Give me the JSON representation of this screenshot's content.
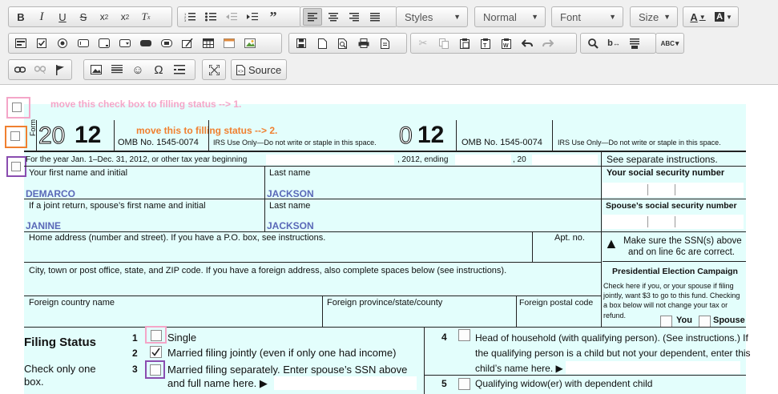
{
  "toolbar": {
    "styles_label": "Styles",
    "format_label": "Normal",
    "font_label": "Font",
    "size_label": "Size",
    "source_label": "Source"
  },
  "notes": {
    "note1": "move this check box to filling status --> 1.",
    "note2": "move this to filling status --> 2."
  },
  "form_header": {
    "form_word": "Form",
    "year_1": "20",
    "year_2": "12",
    "omb_1": "OMB No. 1545-0074",
    "irs_1": "IRS Use Only—Do not write or staple in this space.",
    "year_3": "0",
    "year_4": "12",
    "omb_2": "OMB No. 1545-0074",
    "irs_2": "IRS Use Only—Do not write or staple in this space."
  },
  "form": {
    "year_line": "For the year Jan. 1–Dec. 31, 2012, or other tax year beginning",
    "ending": ", 2012, ending",
    "comma20": ", 20",
    "see_instructions": "See separate instructions.",
    "first_name_label": "Your first name and initial",
    "last_name_label": "Last name",
    "ssn_label": "Your social security number",
    "first_name": "DEMARCO",
    "last_name": "JACKSON",
    "spouse_label": "If a joint return, spouse’s first name and initial",
    "spouse_last_label": "Last name",
    "spouse_ssn_label": "Spouse’s social security number",
    "spouse_first": "JANINE",
    "spouse_last": "JACKSON",
    "address_label": "Home address (number and street). If you have a P.O. box, see instructions.",
    "apt_label": "Apt. no.",
    "ssn_warning_1": "Make sure the SSN(s) above",
    "ssn_warning_2": "and on line 6c are correct.",
    "city_label": "City, town or post office, state, and ZIP code. If you have a foreign address, also complete spaces below (see instructions).",
    "pec_title": "Presidential Election Campaign",
    "pec_text_1": "Check here if you, or your spouse if filing",
    "pec_text_2": "jointly, want $3 to go to this fund. Checking",
    "pec_text_3": "a box below will not change your tax or",
    "pec_text_4": "refund.",
    "you_label": "You",
    "spouse_cb_label": "Spouse",
    "foreign_country": "Foreign country name",
    "foreign_province": "Foreign province/state/county",
    "foreign_postal": "Foreign postal code"
  },
  "filing": {
    "title": "Filing Status",
    "check_only_1": "Check only one",
    "check_only_2": "box.",
    "n1": "1",
    "opt1": "Single",
    "n2": "2",
    "opt2": "Married filing jointly (even if only one had income)",
    "n3": "3",
    "opt3_1": "Married filing separately. Enter spouse’s SSN above",
    "opt3_2": "and full name here. ▶",
    "n4": "4",
    "opt4_1": "Head of household (with qualifying person). (See instructions.) If",
    "opt4_2": "the qualifying person is a child but not your dependent, enter this",
    "opt4_3": "child’s name here. ▶",
    "n5": "5",
    "opt5": "Qualifying widow(er) with dependent child"
  },
  "colors": {
    "pink": "#f4a6c8",
    "orange": "#f08030",
    "purple": "#8a4db0",
    "form_bg": "#e3fefc",
    "name_blue": "#5a68b8"
  }
}
